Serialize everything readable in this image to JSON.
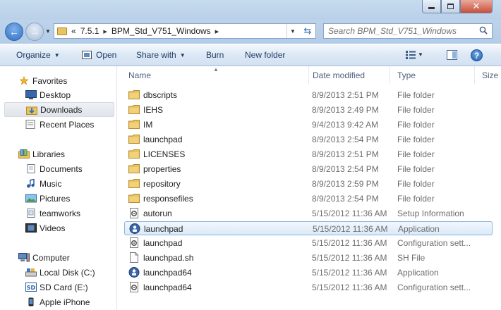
{
  "window": {
    "caption_buttons": [
      "minimize-icon",
      "maximize-icon",
      "close-icon"
    ]
  },
  "address": {
    "overflow": "«",
    "crumbs": [
      "7.5.1",
      "BPM_Std_V751_Windows"
    ],
    "search_placeholder": "Search BPM_Std_V751_Windows"
  },
  "toolbar": {
    "organize": "Organize",
    "open": "Open",
    "share_with": "Share with",
    "burn": "Burn",
    "new_folder": "New folder"
  },
  "nav": {
    "favorites": {
      "label": "Favorites",
      "items": [
        "Desktop",
        "Downloads",
        "Recent Places"
      ]
    },
    "libraries": {
      "label": "Libraries",
      "items": [
        "Documents",
        "Music",
        "Pictures",
        "teamworks",
        "Videos"
      ]
    },
    "computer": {
      "label": "Computer",
      "items": [
        "Local Disk (C:)",
        "SD Card (E:)",
        "Apple iPhone"
      ]
    },
    "selected": "Downloads"
  },
  "columns": [
    "Name",
    "Date modified",
    "Type",
    "Size"
  ],
  "files": [
    {
      "name": "dbscripts",
      "date": "8/9/2013 2:51 PM",
      "type": "File folder",
      "icon": "folder-icon"
    },
    {
      "name": "IEHS",
      "date": "8/9/2013 2:49 PM",
      "type": "File folder",
      "icon": "folder-icon"
    },
    {
      "name": "IM",
      "date": "9/4/2013 9:42 AM",
      "type": "File folder",
      "icon": "folder-icon"
    },
    {
      "name": "launchpad",
      "date": "8/9/2013 2:54 PM",
      "type": "File folder",
      "icon": "folder-icon"
    },
    {
      "name": "LICENSES",
      "date": "8/9/2013 2:51 PM",
      "type": "File folder",
      "icon": "folder-icon"
    },
    {
      "name": "properties",
      "date": "8/9/2013 2:54 PM",
      "type": "File folder",
      "icon": "folder-icon"
    },
    {
      "name": "repository",
      "date": "8/9/2013 2:59 PM",
      "type": "File folder",
      "icon": "folder-icon"
    },
    {
      "name": "responsefiles",
      "date": "8/9/2013 2:54 PM",
      "type": "File folder",
      "icon": "folder-icon"
    },
    {
      "name": "autorun",
      "date": "5/15/2012 11:36 AM",
      "type": "Setup Information",
      "icon": "settings-file-icon"
    },
    {
      "name": "launchpad",
      "date": "5/15/2012 11:36 AM",
      "type": "Application",
      "icon": "application-icon"
    },
    {
      "name": "launchpad",
      "date": "5/15/2012 11:36 AM",
      "type": "Configuration sett...",
      "icon": "settings-file-icon"
    },
    {
      "name": "launchpad.sh",
      "date": "5/15/2012 11:36 AM",
      "type": "SH File",
      "icon": "blank-file-icon"
    },
    {
      "name": "launchpad64",
      "date": "5/15/2012 11:36 AM",
      "type": "Application",
      "icon": "application-icon"
    },
    {
      "name": "launchpad64",
      "date": "5/15/2012 11:36 AM",
      "type": "Configuration sett...",
      "icon": "settings-file-icon"
    }
  ],
  "selected_file_index": 9,
  "colors": {
    "folder": "#e8c35e",
    "selection_border": "#8cb3de",
    "header_text": "#4c607a",
    "meta_text": "#6d6d6d"
  }
}
